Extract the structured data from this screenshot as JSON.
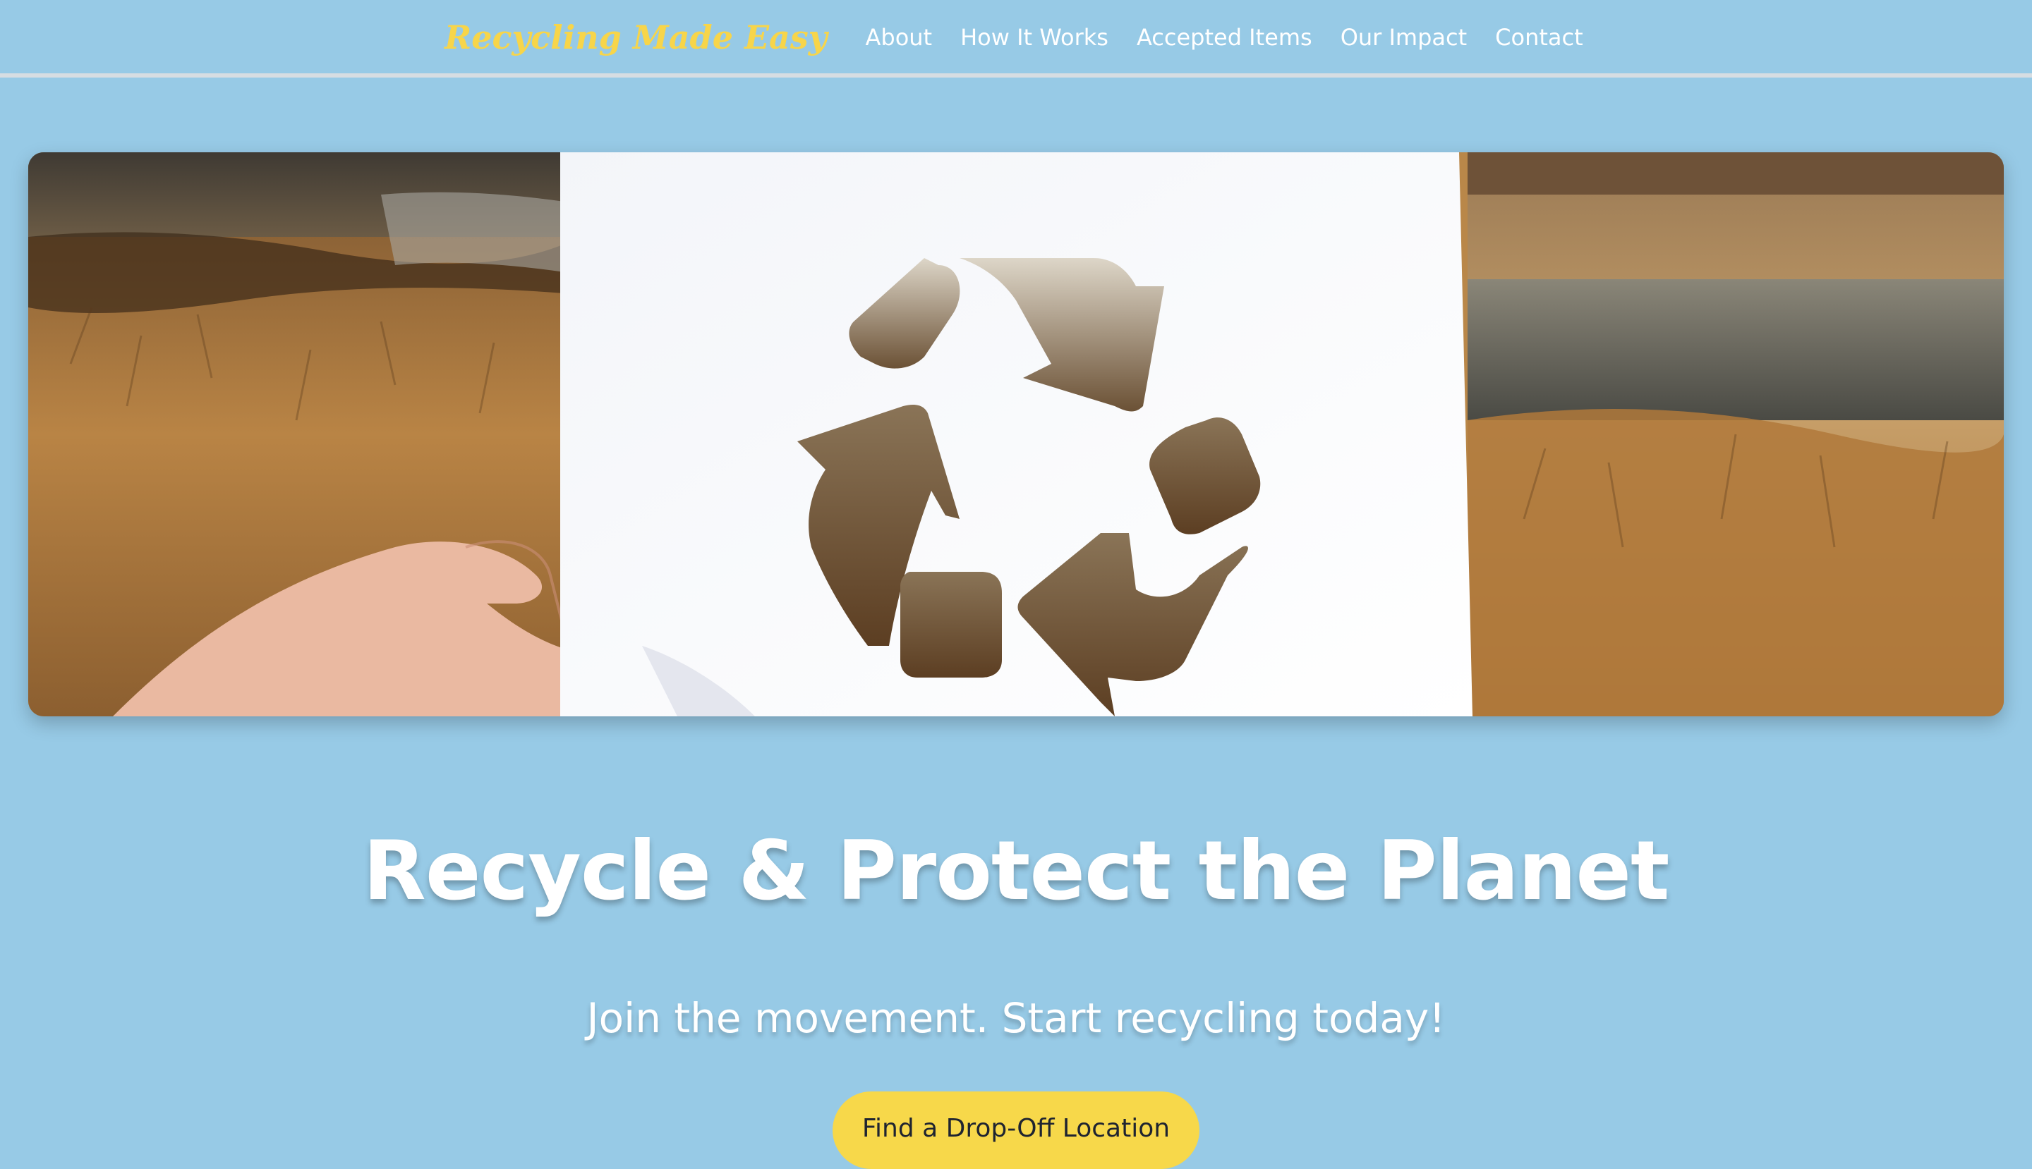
{
  "nav": {
    "brand": "Recycling Made Easy",
    "links": [
      {
        "label": "About"
      },
      {
        "label": "How It Works"
      },
      {
        "label": "Accepted Items"
      },
      {
        "label": "Our Impact"
      },
      {
        "label": "Contact"
      }
    ]
  },
  "hero_image": {
    "icon": "recycle-icon"
  },
  "main": {
    "headline": "Recycle & Protect the Planet",
    "subheadline": "Join the movement. Start recycling today!",
    "cta_label": "Find a Drop-Off Location"
  },
  "colors": {
    "background": "#97cae6",
    "brand": "#f7d54a",
    "cta": "#f7d84a",
    "text_light": "#ffffff"
  }
}
